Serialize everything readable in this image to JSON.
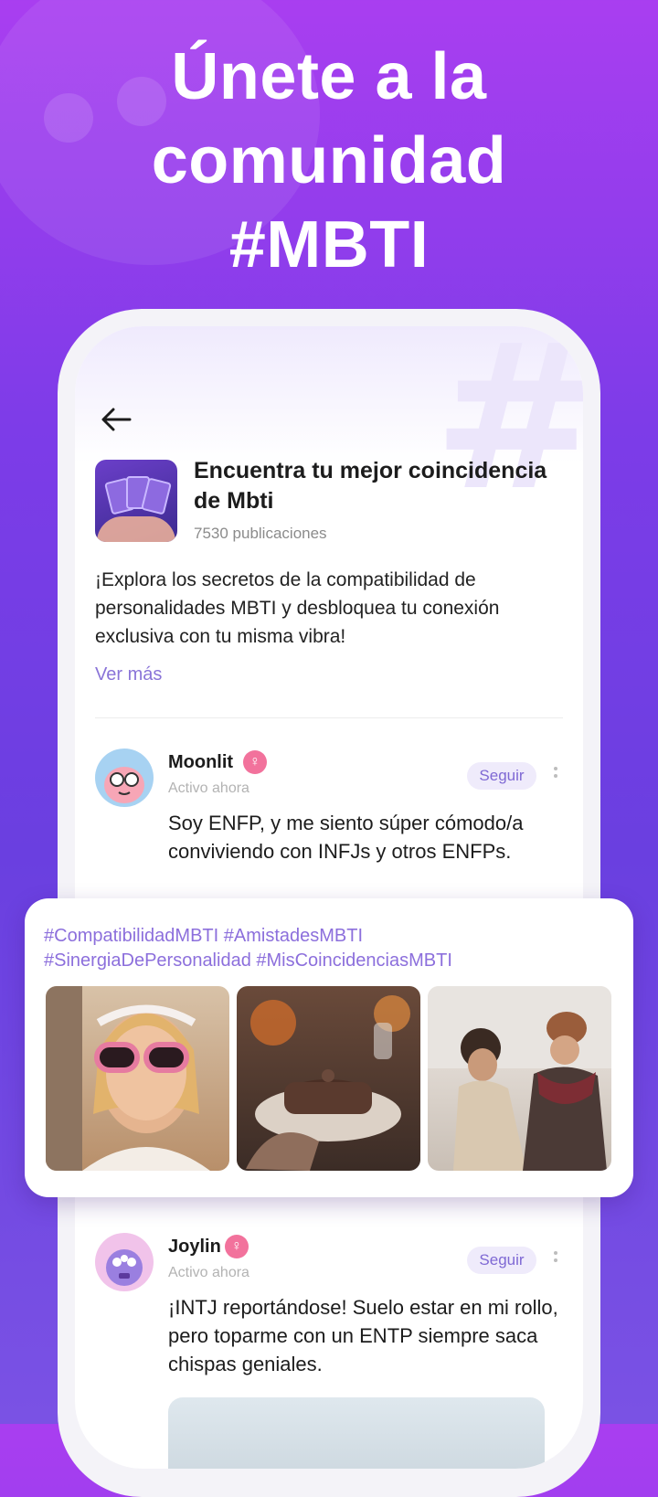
{
  "headline": {
    "line1": "Únete a la",
    "line2": "comunidad",
    "line3": "#MBTI"
  },
  "topic": {
    "title": "Encuentra tu mejor coincidencia de Mbti",
    "count": "7530 publicaciones",
    "description": "¡Explora los secretos de la compatibilidad de personalidades MBTI y desbloquea tu conexión exclusiva con tu misma vibra!",
    "more": "Ver más"
  },
  "posts": [
    {
      "username": "Moonlit",
      "status": "Activo ahora",
      "follow": "Seguir",
      "text": "Soy ENFP, y me siento súper cómodo/a conviviendo con INFJs y otros ENFPs."
    },
    {
      "username": "Joylin",
      "status": "Activo ahora",
      "follow": "Seguir",
      "text": "¡INTJ reportándose! Suelo estar en mi rollo, pero toparme con un ENTP siempre saca chispas geniales."
    }
  ],
  "hashtags": {
    "line1": "#CompatibilidadMBTI #AmistadesMBTI",
    "line2": "#SinergiaDePersonalidad #MisCoincidenciasMBTI"
  },
  "icons": {
    "back": "arrow-left-icon",
    "gender": "female-symbol-icon",
    "more": "kebab-menu-icon"
  },
  "colors": {
    "accent": "#8c6fdc",
    "badge": "#f2729c",
    "follow_bg": "#efebfb"
  }
}
